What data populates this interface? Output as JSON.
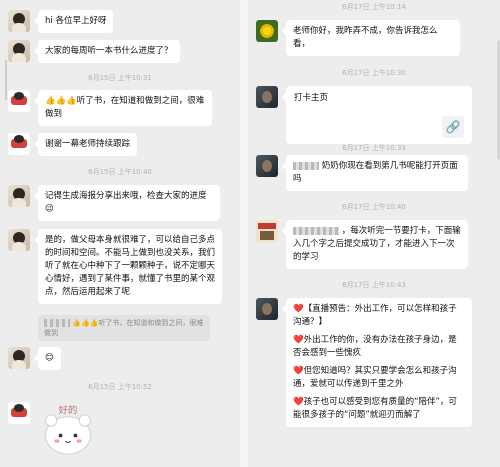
{
  "left": {
    "messages": [
      {
        "text": "hi 各位早上好呀"
      },
      {
        "text": "大家的每周听一本书什么进度了？"
      },
      {
        "time": "6月15日 上午10:31"
      },
      {
        "text": "👍👍👍听了书，在知道和做到之间，很难做到"
      },
      {
        "text": "谢谢一幕老师持续跟踪"
      },
      {
        "time": "6月15日 上午10:40"
      },
      {
        "text": "记得生成海报分享出来哦，检查大家的进度😉"
      },
      {
        "text": "是的，做父母本身就很难了，可以给自己多点的时间和空间。不能马上做到也没关系，我们听了就在心中种下了一颗颗种子，说不定哪天心情好，遇到了某件事，就懂了书里的某个观点，然后运用起来了呢"
      },
      {
        "quote": "👍👍👍听了书，在知道和做到之间，很难做到"
      },
      {
        "text": "😊"
      },
      {
        "time": "6月15日 上午10:52"
      },
      {
        "sticker": "好的"
      }
    ]
  },
  "right": {
    "messages": [
      {
        "time": "6月17日 上午10:14"
      },
      {
        "text": "老师你好，我昨弄不成，你告诉我怎么看，"
      },
      {
        "time": "6月17日 上午10:30"
      },
      {
        "text": "打卡主页",
        "icon": "link-icon"
      },
      {
        "time": "6月17日 上午10:33"
      },
      {
        "text": "奶奶你现在看到第几书呢能打开页面吗"
      },
      {
        "time": "6月17日 上午10:40"
      },
      {
        "text": "，每次听完一节要打卡，下面输入几个字之后提交成功了，才能进入下一次的学习"
      },
      {
        "time": "6月17日 上午10:43"
      },
      {
        "text": "❤️【直播预告：外出工作，可以怎样和孩子沟通？】"
      },
      {
        "text": "❤️外出工作的你，没有办法在孩子身边，是否会感到一些愧疚"
      },
      {
        "text": "❤️但您知道吗？其实只要学会怎么和孩子沟通，爱就可以传递到千里之外"
      },
      {
        "text": "❤️孩子也可以感受到您有质量的“陪伴”，可能很多孩子的“问题”就迎刃而解了"
      }
    ]
  },
  "colors": {
    "background": "#ededed",
    "bubble": "#ffffff",
    "time_text": "#b0b0b0"
  }
}
